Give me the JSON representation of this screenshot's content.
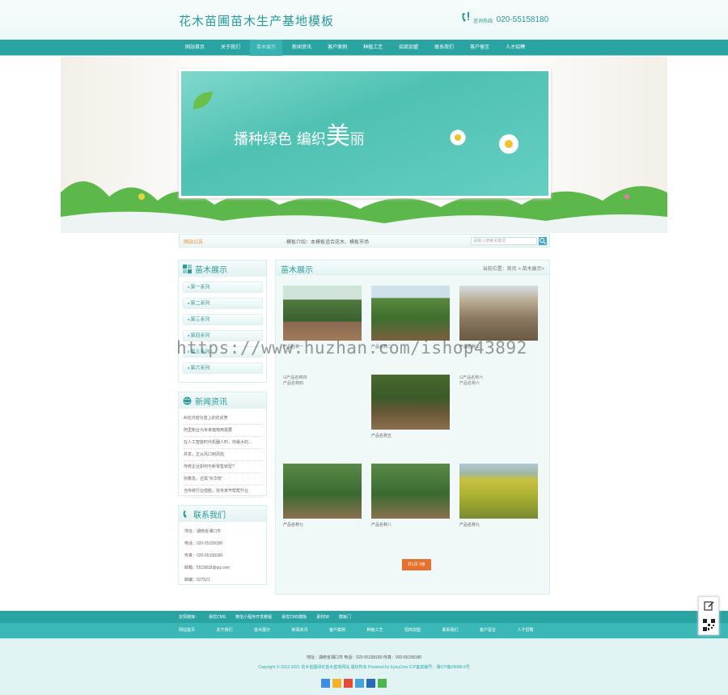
{
  "header": {
    "title": "花木苗圃苗木生产基地模板",
    "phone_label": "咨询热线:",
    "phone": "020-55158180"
  },
  "nav": [
    "网站首页",
    "关于我们",
    "苗木展示",
    "新闻资讯",
    "客户案例",
    "种植工艺",
    "招商加盟",
    "联系我们",
    "客户留言",
    "人才招聘"
  ],
  "nav_active_index": 2,
  "banner": {
    "text1": "播种绿色 编织",
    "text2": "美",
    "text3": "丽"
  },
  "search": {
    "title": "网站公告",
    "hot": "模板介绍：本模板适合花木、模板市场",
    "placeholder": "请输入搜索关键词"
  },
  "sidebar": {
    "cat_title": "苗木展示",
    "categories": [
      "第一系列",
      "第二系列",
      "第三系列",
      "第四系列",
      "第五系列",
      "第六系列"
    ],
    "news_title": "新闻资讯",
    "news": [
      "AI在内容分发上的优劣势",
      "阿里新业为未来植物用需要",
      "在人工智能时代机器人时，你最大的...",
      "共享，正从风口到风险",
      "传统企业如何与新零售转型?",
      "别着急，还需“买华枝”",
      "当传统行业借脸，信专家开帮帮升业"
    ],
    "contact_title": "联系我们",
    "contact": [
      "地址：湖南省湘口市",
      "电话：020-55158180",
      "传真：020-55158180",
      "邮箱：5515818@qq.com",
      "邮编：527521"
    ]
  },
  "main": {
    "title": "苗木展示",
    "crumb": "当前位置：首页 > 苗木展示>",
    "products": [
      {
        "name": "产品名称一",
        "broken": false
      },
      {
        "name": "产品名称二",
        "broken": false
      },
      {
        "name": "产品名称三",
        "broken": false
      },
      {
        "name": "产品名称四",
        "broken": true,
        "alt": "产品名称四"
      },
      {
        "name": "产品名称五",
        "broken": false
      },
      {
        "name": "产品名称六",
        "broken": true,
        "alt": "产品名称六"
      },
      {
        "name": "产品名称七",
        "broken": false
      },
      {
        "name": "产品名称八",
        "broken": false
      },
      {
        "name": "产品名称九",
        "broken": false
      }
    ],
    "pager": "共1页 9条"
  },
  "footer": {
    "links_label": "友情链接：",
    "links": [
      "易优CMS",
      "微信小程序开发教程",
      "易优CMS模板",
      "素材58",
      "模板门"
    ],
    "nav": [
      "网站首页",
      "关于我们",
      "苗木展示",
      "新闻资讯",
      "客户案例",
      "种植工艺",
      "招商加盟",
      "联系我们",
      "客户留言",
      "人才招聘"
    ],
    "address": "地址：湖南省湘口市  电话：020-55158180  传真：020-55158180",
    "copyright": "Copyright © 2012-2021 花木苗圃绿化苗木基地网站 版权所有 Powered by EyouCms  ICP备案编号：湘ICP备09089-5号"
  },
  "watermark": "https://www.huzhan.com/ishop43892",
  "colors": {
    "primary": "#2aa3a3",
    "accent": "#e8702a"
  }
}
